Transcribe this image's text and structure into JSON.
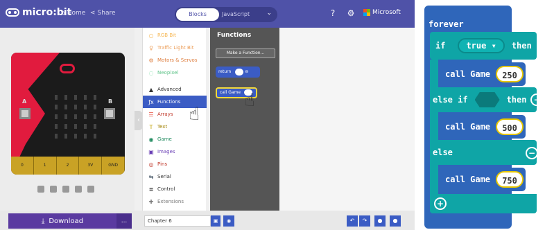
{
  "app": {
    "logo": "micro:bit",
    "nav_home": "Home",
    "nav_share": "Share",
    "tab_blocks": "Blocks",
    "tab_javascript": "JavaScript",
    "brand": "Microsoft",
    "brand_colors": [
      "#f25022",
      "#7fba00",
      "#00a4ef",
      "#ffb900"
    ],
    "topbar_color": "#4f52a8"
  },
  "simulator": {
    "button_a": "A",
    "button_b": "B",
    "pins": [
      "0",
      "1",
      "2",
      "3V",
      "GND"
    ]
  },
  "toolbox": {
    "categories": [
      {
        "label": "RGB Bit",
        "icon": "○",
        "color": "#f39c12"
      },
      {
        "label": "Traffic Light Bit",
        "icon": "♀",
        "color": "#e67e22"
      },
      {
        "label": "Motors & Servos",
        "icon": "⚙",
        "color": "#d35400"
      },
      {
        "label": "Neopixel",
        "icon": "◌",
        "color": "#2ecc71"
      },
      {
        "label": "Advanced",
        "icon": "▲",
        "color": "#333333"
      },
      {
        "label": "Functions",
        "icon": "ƒx",
        "color": "#3b5cc4"
      },
      {
        "label": "Arrays",
        "icon": "☰",
        "color": "#e74c3c"
      },
      {
        "label": "Text",
        "icon": "T",
        "color": "#c0a000"
      },
      {
        "label": "Game",
        "icon": "◉",
        "color": "#1e8a5e"
      },
      {
        "label": "Images",
        "icon": "▣",
        "color": "#6a3fb5"
      },
      {
        "label": "Pins",
        "icon": "◎",
        "color": "#c0392b"
      },
      {
        "label": "Serial",
        "icon": "⇆",
        "color": "#2c3e50"
      },
      {
        "label": "Control",
        "icon": "≣",
        "color": "#333333"
      },
      {
        "label": "Extensions",
        "icon": "✚",
        "color": "#777777"
      }
    ]
  },
  "flyout": {
    "title": "Functions",
    "make_button": "Make a Function...",
    "return_block": "return",
    "call_block": "call Game"
  },
  "bottombar": {
    "download": "Download",
    "more": "...",
    "project_name": "Chapter 6"
  },
  "blocks": {
    "forever": "forever",
    "if": "if",
    "true_value": "true ▾",
    "then": "then",
    "else_if": "else if",
    "else": "else",
    "call_label": "call Game",
    "call_values": [
      "250",
      "500",
      "750"
    ],
    "forever_color": "#2f66ba",
    "logic_color": "#0fa5a6"
  }
}
